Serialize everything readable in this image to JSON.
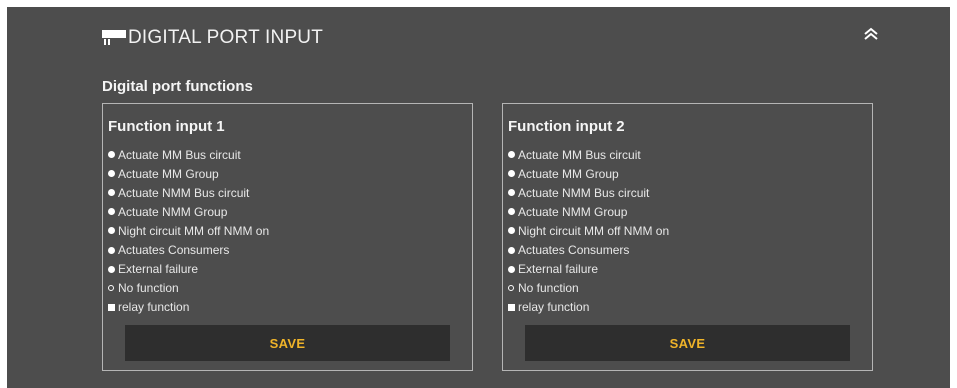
{
  "header": {
    "title": "DIGITAL PORT INPUT",
    "icon": "port-icon",
    "collapse_icon": "double-chevron-up-icon"
  },
  "section": {
    "title": "Digital port functions"
  },
  "function_inputs": [
    {
      "title": "Function input 1",
      "options": [
        {
          "label": "Actuate MM Bus circuit",
          "marker": "filled-dot"
        },
        {
          "label": "Actuate MM Group",
          "marker": "filled-dot"
        },
        {
          "label": "Actuate NMM Bus circuit",
          "marker": "filled-dot"
        },
        {
          "label": "Actuate NMM Group",
          "marker": "filled-dot"
        },
        {
          "label": "Night circuit MM off NMM on",
          "marker": "filled-dot"
        },
        {
          "label": "Actuates Consumers",
          "marker": "filled-dot"
        },
        {
          "label": "External failure",
          "marker": "filled-dot"
        },
        {
          "label": "No function",
          "marker": "hollow-dot"
        },
        {
          "label": "relay function",
          "marker": "square"
        }
      ],
      "save_label": "SAVE"
    },
    {
      "title": "Function input 2",
      "options": [
        {
          "label": "Actuate MM Bus circuit",
          "marker": "filled-dot"
        },
        {
          "label": "Actuate MM Group",
          "marker": "filled-dot"
        },
        {
          "label": "Actuate NMM Bus circuit",
          "marker": "filled-dot"
        },
        {
          "label": "Actuate NMM Group",
          "marker": "filled-dot"
        },
        {
          "label": "Night circuit MM off NMM on",
          "marker": "filled-dot"
        },
        {
          "label": "Actuates Consumers",
          "marker": "filled-dot"
        },
        {
          "label": "External failure",
          "marker": "filled-dot"
        },
        {
          "label": "No function",
          "marker": "hollow-dot"
        },
        {
          "label": "relay function",
          "marker": "square"
        }
      ],
      "save_label": "SAVE"
    }
  ],
  "colors": {
    "panel_bg": "#4d4d4d",
    "button_bg": "#2e2e2e",
    "accent": "#f0b429",
    "border": "#b5b5b5"
  }
}
